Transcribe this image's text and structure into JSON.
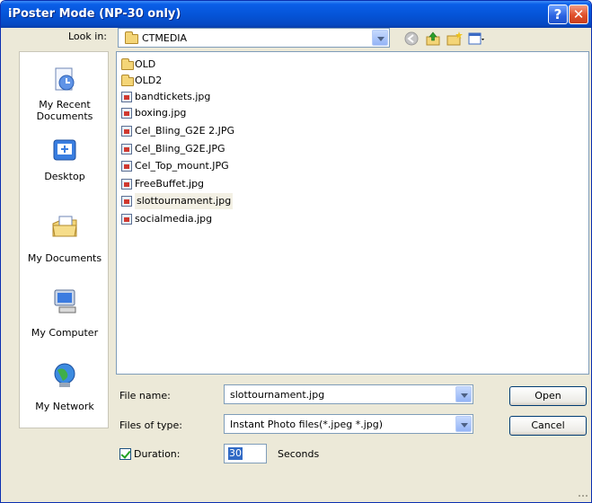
{
  "window": {
    "title": "iPoster Mode (NP-30 only)",
    "help": "?",
    "close": "✕"
  },
  "lookin": {
    "label": "Look in:",
    "value": "CTMEDIA"
  },
  "toolbar": {
    "icons": [
      "back-icon",
      "up-folder-icon",
      "new-folder-icon",
      "view-menu-icon"
    ]
  },
  "places": [
    {
      "label": "My Recent Documents",
      "icon": "recent-documents-icon"
    },
    {
      "label": "Desktop",
      "icon": "desktop-icon"
    },
    {
      "label": "My Documents",
      "icon": "my-documents-icon"
    },
    {
      "label": "My Computer",
      "icon": "my-computer-icon"
    },
    {
      "label": "My Network",
      "icon": "my-network-icon"
    }
  ],
  "files": [
    {
      "name": "OLD",
      "type": "folder"
    },
    {
      "name": "OLD2",
      "type": "folder"
    },
    {
      "name": "bandtickets.jpg",
      "type": "image"
    },
    {
      "name": "boxing.jpg",
      "type": "image"
    },
    {
      "name": "Cel_Bling_G2E 2.JPG",
      "type": "image"
    },
    {
      "name": "Cel_Bling_G2E.JPG",
      "type": "image"
    },
    {
      "name": "Cel_Top_mount.JPG",
      "type": "image"
    },
    {
      "name": "FreeBuffet.jpg",
      "type": "image"
    },
    {
      "name": "slottournament.jpg",
      "type": "image",
      "selected": true
    },
    {
      "name": "socialmedia.jpg",
      "type": "image"
    }
  ],
  "filename": {
    "label": "File name:",
    "value": "slottournament.jpg"
  },
  "filetype": {
    "label": "Files of type:",
    "value": "Instant Photo files(*.jpeg *.jpg)"
  },
  "duration": {
    "label": "Duration:",
    "value": "30",
    "unit": "Seconds",
    "checked": true
  },
  "buttons": {
    "open": "Open",
    "cancel": "Cancel"
  }
}
